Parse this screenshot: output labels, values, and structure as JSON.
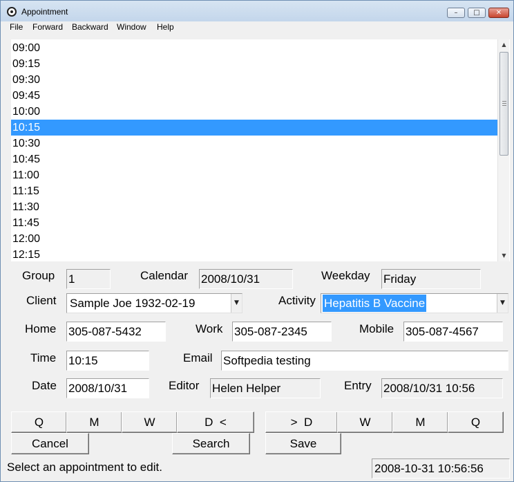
{
  "window": {
    "title": "Appointment",
    "controls": {
      "minimize": "–",
      "maximize": "□",
      "close": "✕"
    }
  },
  "menu": [
    "File",
    "Forward",
    "Backward",
    "Window",
    "Help"
  ],
  "times": [
    "09:00",
    "09:15",
    "09:30",
    "09:45",
    "10:00",
    "10:15",
    "10:30",
    "10:45",
    "11:00",
    "11:15",
    "11:30",
    "11:45",
    "12:00",
    "12:15"
  ],
  "selected_time_index": 5,
  "form": {
    "group": {
      "label": "Group",
      "value": "1"
    },
    "calendar": {
      "label": "Calendar",
      "value": "2008/10/31"
    },
    "weekday": {
      "label": "Weekday",
      "value": "Friday"
    },
    "client": {
      "label": "Client",
      "value": "Sample Joe 1932-02-19"
    },
    "activity": {
      "label": "Activity",
      "value": "Hepatitis B Vaccine"
    },
    "home": {
      "label": "Home",
      "value": "305-087-5432"
    },
    "work": {
      "label": "Work",
      "value": "305-087-2345"
    },
    "mobile": {
      "label": "Mobile",
      "value": "305-087-4567"
    },
    "time": {
      "label": "Time",
      "value": "10:15"
    },
    "email": {
      "label": "Email",
      "value": "Softpedia testing"
    },
    "date": {
      "label": "Date",
      "value": "2008/10/31"
    },
    "editor": {
      "label": "Editor",
      "value": "Helen Helper"
    },
    "entry": {
      "label": "Entry",
      "value": "2008/10/31 10:56"
    }
  },
  "nav_buttons": {
    "back_q": "Q",
    "back_m": "M",
    "back_w": "W",
    "back_d": "D  <",
    "fwd_d": ">  D",
    "fwd_w": "W",
    "fwd_m": "M",
    "fwd_q": "Q"
  },
  "actions": {
    "cancel": "Cancel",
    "search": "Search",
    "save": "Save"
  },
  "status": {
    "message": "Select an appointment to edit.",
    "clock": "2008-10-31 10:56:56"
  },
  "icons": {
    "app": "clock-icon",
    "scroll_up": "▲",
    "scroll_down": "▼",
    "dropdown": "▼"
  },
  "colors": {
    "selection": "#3399ff",
    "close_button": "#c8452f"
  }
}
